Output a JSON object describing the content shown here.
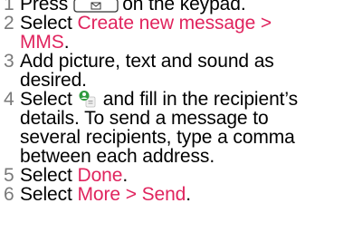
{
  "colors": {
    "text": "#000000",
    "step_number": "#7a7a7a",
    "highlight": "#e0245e"
  },
  "steps": [
    {
      "number": "1",
      "before": "Press",
      "icon": "message-key-icon",
      "after": "on the keypad."
    },
    {
      "number": "2",
      "before": "Select",
      "highlight_line1": "Create new message >",
      "highlight_line2": "MMS",
      "after": "."
    },
    {
      "number": "3",
      "line1": "Add picture, text and sound as",
      "line2": "desired."
    },
    {
      "number": "4",
      "before": "Select",
      "icon": "add-recipient-icon",
      "after": "and fill in the recipient’s",
      "line2": "details. To send a message to",
      "line3": "several recipients, type a comma",
      "line4": "between each address."
    },
    {
      "number": "5",
      "before": "Select",
      "highlight": "Done",
      "after": "."
    },
    {
      "number": "6",
      "before": "Select",
      "highlight": "More > Send",
      "after": "."
    }
  ]
}
